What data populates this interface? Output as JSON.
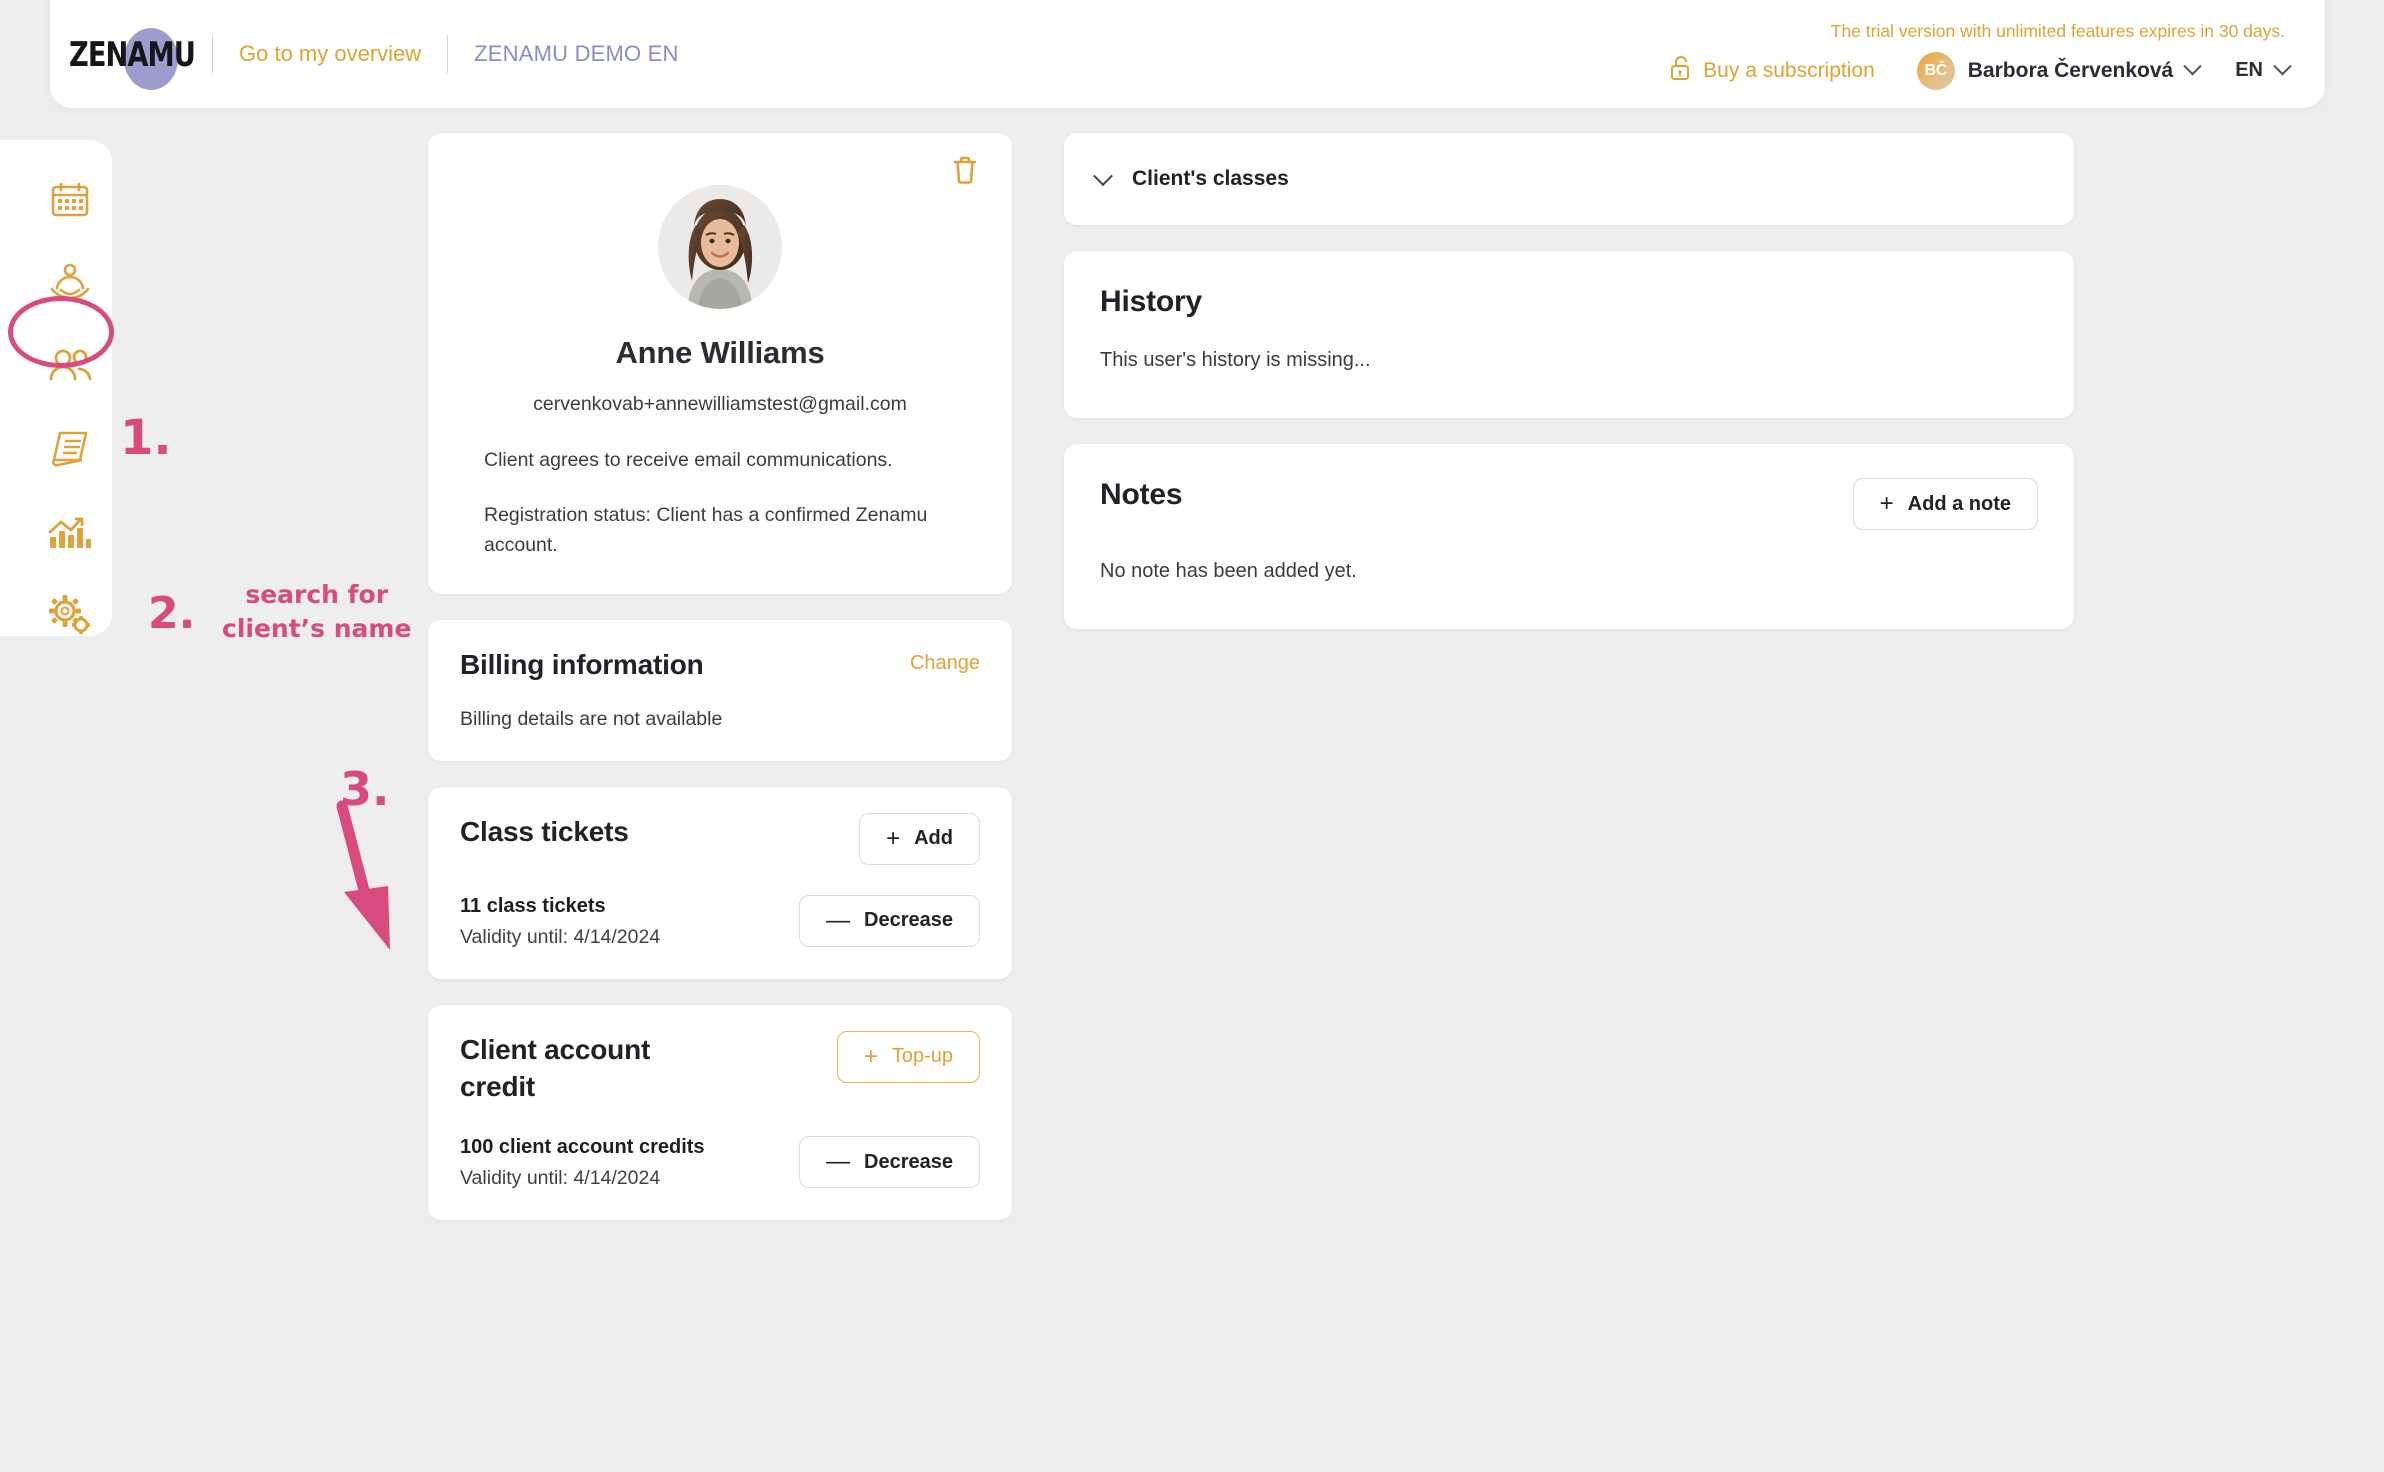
{
  "header": {
    "logo_text": "ZENAMU",
    "overview_link": "Go to my overview",
    "studio_name": "ZENAMU DEMO EN",
    "trial_note": "The trial version with unlimited features expires in 30 days.",
    "buy_subscription": "Buy a subscription",
    "lock_icon": "lock-open-icon",
    "user_initials": "BČ",
    "user_name": "Barbora Červenková",
    "language": "EN"
  },
  "sidebar": {
    "items": [
      {
        "name": "calendar",
        "icon": "calendar-icon",
        "active": false
      },
      {
        "name": "classes",
        "icon": "yoga-lotus-icon",
        "active": false
      },
      {
        "name": "clients",
        "icon": "people-icon",
        "active": true
      },
      {
        "name": "invoices",
        "icon": "invoice-document-icon",
        "active": false
      },
      {
        "name": "statistics",
        "icon": "bar-chart-icon",
        "active": false
      },
      {
        "name": "settings",
        "icon": "gears-icon",
        "active": false
      }
    ]
  },
  "annotations": {
    "step1": "1.",
    "step2_number": "2.",
    "step2_text_line1": "search for",
    "step2_text_line2": "client’s name",
    "step3": "3.",
    "color": "#d94a7e"
  },
  "profile": {
    "delete_icon": "trash-icon",
    "photo_alt": "client-photo",
    "name": "Anne Williams",
    "email": "cervenkovab+annewilliamstest@gmail.com",
    "consent_text": "Client agrees to receive email communications.",
    "registration_text": "Registration status: Client has a confirmed Zenamu account."
  },
  "billing": {
    "title": "Billing information",
    "change_label": "Change",
    "details": "Billing details are not available"
  },
  "class_tickets": {
    "title": "Class tickets",
    "add_label": "Add",
    "add_glyph": "+",
    "count_label": "11 class tickets",
    "validity": "Validity until: 4/14/2024",
    "decrease_label": "Decrease",
    "decrease_glyph": "—"
  },
  "account_credit": {
    "title": "Client account credit",
    "topup_label": "Top-up",
    "topup_glyph": "+",
    "count_label": "100 client account credits",
    "validity": "Validity until: 4/14/2024",
    "decrease_label": "Decrease",
    "decrease_glyph": "—"
  },
  "clients_classes": {
    "label": "Client's classes",
    "chevron": "chevron-down-icon"
  },
  "history": {
    "title": "History",
    "empty_text": "This user's history is missing..."
  },
  "notes": {
    "title": "Notes",
    "add_label": "Add a note",
    "add_glyph": "+",
    "empty_text": "No note has been added yet."
  },
  "colors": {
    "accent": "#e0a331",
    "annotation": "#d94a7e",
    "brand_purple": "#8b8cc4",
    "page_bg": "#eeeeee"
  }
}
